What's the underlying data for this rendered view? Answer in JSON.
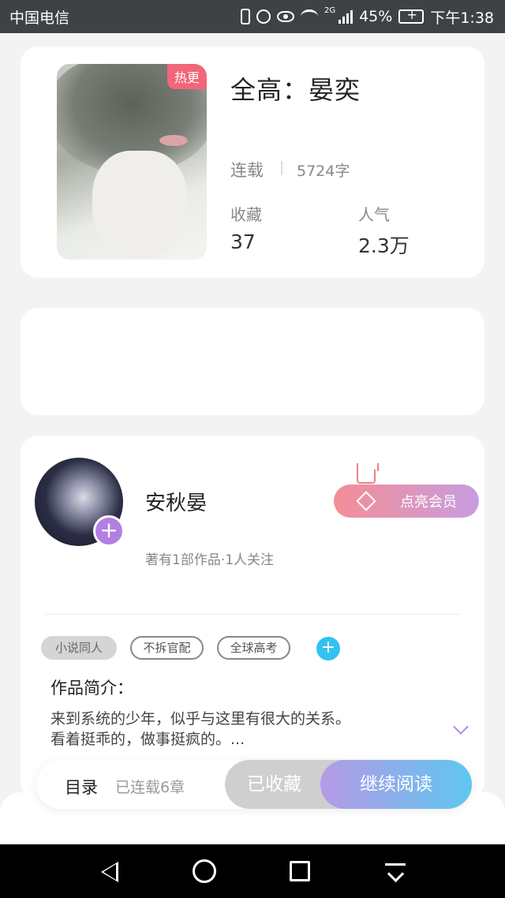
{
  "status_bar": {
    "carrier": "中国电信",
    "network": "2G",
    "battery": "45%",
    "time": "下午1:38"
  },
  "book": {
    "hot_tag": "热更",
    "title": "全高：晏奕",
    "status": "连载",
    "word_count": "5724字",
    "stats": [
      {
        "label": "收藏",
        "value": "37"
      },
      {
        "label": "人气",
        "value": "2.3万"
      }
    ]
  },
  "author": {
    "name": "安秋晏",
    "meta": "著有1部作品·1人关注",
    "vip_button": "点亮会员",
    "plus": "+"
  },
  "tags": {
    "items": [
      "小说同人",
      "不拆官配",
      "全球高考"
    ],
    "add": "+"
  },
  "intro": {
    "title": "作品简介：",
    "line1": "来到系统的少年，似乎与这里有很大的关系。",
    "line2": "看着挺乖的，做事挺疯的。..."
  },
  "actions": {
    "toc": "目录",
    "chapters": "已连载6章",
    "saved": "已收藏",
    "read": "继续阅读"
  },
  "colors": {
    "accent_pink": "#f2667a",
    "accent_purple": "#b27fe2",
    "accent_blue": "#32c2f0"
  }
}
